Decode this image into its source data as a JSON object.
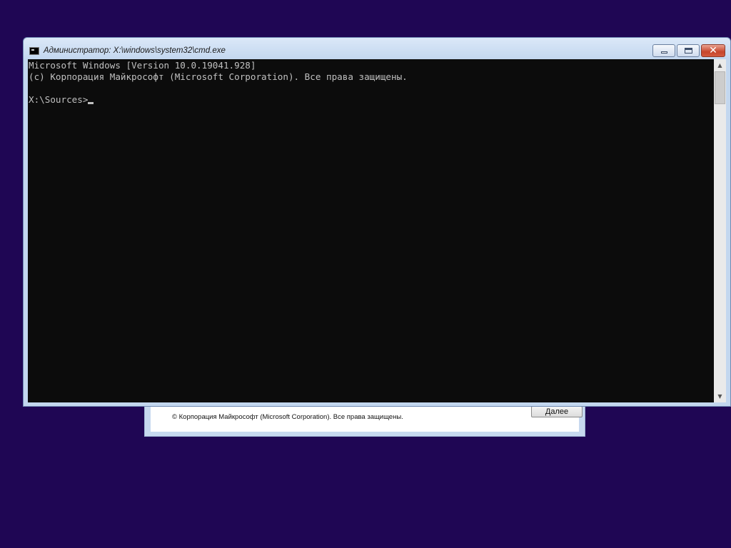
{
  "window": {
    "title": "Администратор: X:\\windows\\system32\\cmd.exe"
  },
  "console": {
    "lines": [
      "Microsoft Windows [Version 10.0.19041.928]",
      "(c) Корпорация Майкрософт (Microsoft Corporation). Все права защищены.",
      "",
      "X:\\Sources>"
    ]
  },
  "setup_dialog": {
    "copyright": "© Корпорация Майкрософт (Microsoft Corporation). Все права защищены.",
    "next_label": "Далее"
  },
  "icons": {
    "window": "cmd-icon",
    "minimize": "minimize-icon",
    "maximize": "maximize-icon",
    "close": "close-icon",
    "scroll_up": "scroll-up-arrow-icon",
    "scroll_down": "scroll-down-arrow-icon"
  },
  "colors": {
    "desktop": "#1f0654",
    "console_bg": "#0c0c0c",
    "console_fg": "#c0c0c0",
    "close_button": "#c7452c"
  }
}
